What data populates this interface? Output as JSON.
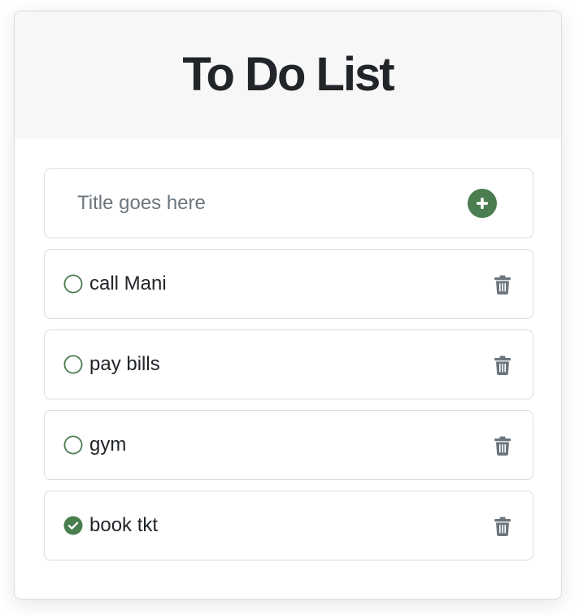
{
  "header": {
    "title": "To Do List"
  },
  "input": {
    "value": "",
    "placeholder": "Title goes here",
    "add_icon": "plus-circle-icon"
  },
  "tasks": [
    {
      "label": "call Mani",
      "done": false
    },
    {
      "label": "pay bills",
      "done": false
    },
    {
      "label": "gym",
      "done": false
    },
    {
      "label": "book tkt",
      "done": true
    }
  ],
  "icons": {
    "unchecked": "circle-icon",
    "checked": "check-circle-icon",
    "delete": "trash-icon"
  },
  "colors": {
    "accent": "#4a7d4f",
    "icon_gray": "#6c757d",
    "text": "#212529",
    "header_bg": "#f7f7f7",
    "border": "#dddddd"
  }
}
